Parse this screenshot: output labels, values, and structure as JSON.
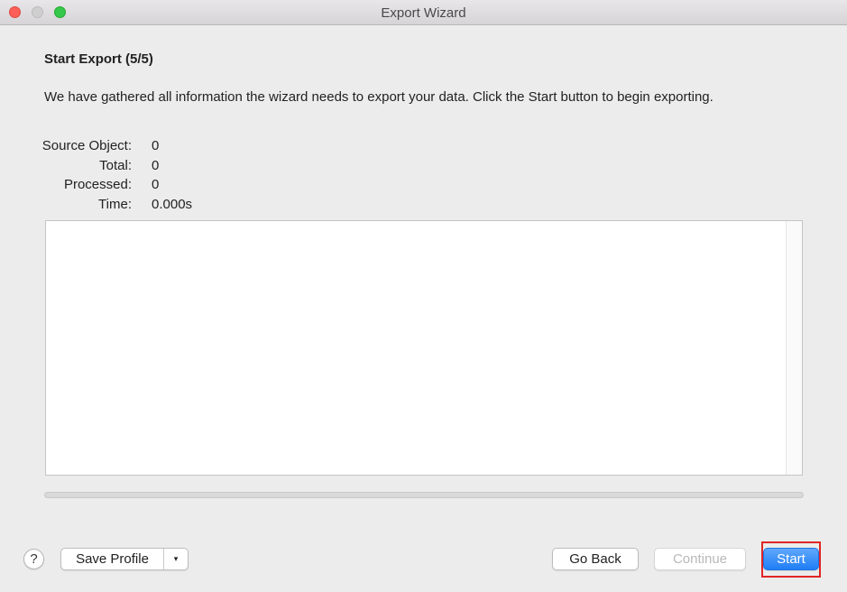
{
  "window": {
    "title": "Export Wizard"
  },
  "step": {
    "heading": "Start Export (5/5)",
    "description": "We have gathered all information the wizard needs to export your data. Click the Start button to begin exporting."
  },
  "stats": [
    {
      "label": "Source Object:",
      "value": "0"
    },
    {
      "label": "Total:",
      "value": "0"
    },
    {
      "label": "Processed:",
      "value": "0"
    },
    {
      "label": "Time:",
      "value": "0.000s"
    }
  ],
  "progress": {
    "fraction": 0
  },
  "footer": {
    "help_label": "?",
    "save_profile_label": "Save Profile",
    "save_profile_caret": "▾",
    "go_back_label": "Go Back",
    "continue_label": "Continue",
    "start_label": "Start"
  },
  "colors": {
    "accent": "#1f7ef6",
    "highlight": "#e02525"
  }
}
